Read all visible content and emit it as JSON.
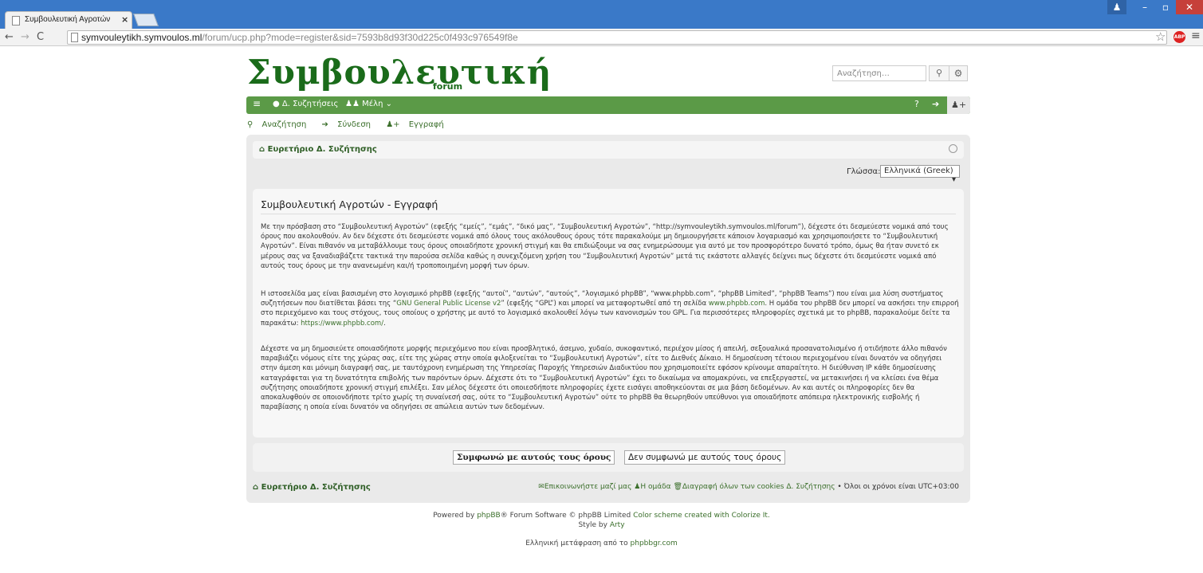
{
  "browser": {
    "tab_title": "Συμβουλευτική Αγροτών",
    "url_host": "symvouleytikh.symvoulos.ml",
    "url_path": "/forum/ucp.php?mode=register&sid=7593b8d93f30d225c0f493c976549f8e",
    "abp_label": "ABP"
  },
  "header": {
    "logo": "Συμβουλευτική",
    "logo_sub": "forum",
    "search_placeholder": "Αναζήτηση…"
  },
  "navbar": {
    "forums_label": "Δ. Συζητήσεις",
    "members_label": "Μέλη"
  },
  "quicklinks": {
    "search": "Αναζήτηση",
    "login": "Σύνδεση",
    "register": "Εγγραφή"
  },
  "breadcrumb": "Ευρετήριο Δ. Συζήτησης",
  "language": {
    "label": "Γλώσσα:",
    "selected": "Ελληνικά (Greek)"
  },
  "panel": {
    "title": "Συμβουλευτική Αγροτών - Εγγραφή",
    "p1": "Με την πρόσβαση στο “Συμβουλευτική Αγροτών” (εφεξής “εμείς”, “εμάς”, “δικό μας”, “Συμβουλευτική Αγροτών”, “http://symvouleytikh.symvoulos.ml/forum”), δέχεστε ότι δεσμεύεστε νομικά από τους όρους που ακολουθούν. Αν δεν δέχεστε ότι δεσμεύεστε νομικά από όλους τους ακόλουθους όρους τότε παρακαλούμε μη δημιουργήσετε κάποιον λογαριασμό και χρησιμοποιήσετε το “Συμβουλευτική Αγροτών”. Είναι πιθανόν να μεταβάλλουμε τους όρους οποιαδήποτε χρονική στιγμή και θα επιδιώξουμε να σας ενημερώσουμε για αυτό με τον προσφορότερο δυνατό τρόπο, όμως θα ήταν συνετό εκ μέρους σας να ξαναδιαβάζετε τακτικά την παρούσα σελίδα καθώς η συνεχιζόμενη χρήση του “Συμβουλευτική Αγροτών” μετά τις εκάστοτε αλλαγές δείχνει πως δέχεστε ότι δεσμεύεστε νομικά από αυτούς τους όρους με την ανανεωμένη και/ή τροποποιημένη μορφή των όρων.",
    "p2_a": "Η ιστοσελίδα μας είναι βασισμένη στο λογισμικό phpBB (εφεξής “αυτοί”, “αυτών”, “αυτούς”, “λογισμικό phpBB”, “www.phpbb.com”, “phpBB Limited”, “phpBB Teams”) που είναι μια λύση συστήματος συζητήσεων που διατίθεται βάσει της “",
    "p2_link1": "GNU General Public License v2",
    "p2_b": "” (εφεξής “GPL”) και μπορεί να μεταφορτωθεί από τη σελίδα ",
    "p2_link2": "www.phpbb.com",
    "p2_c": ". Η ομάδα του phpBB δεν μπορεί να ασκήσει την επιρροή στο περιεχόμενο και τους στόχους, τους οποίους ο χρήστης με αυτό το λογισμικό ακολουθεί λόγω των κανονισμών του GPL. Για περισσότερες πληροφορίες σχετικά με το phpBB, παρακαλούμε δείτε τα παρακάτω: ",
    "p2_link3": "https://www.phpbb.com/",
    "p2_d": ".",
    "p3": "Δέχεστε να μη δημοσιεύετε οποιασδήποτε μορφής περιεχόμενο που είναι προσβλητικό, άσεμνο, χυδαίο, συκοφαντικό, περιέχον μίσος ή απειλή, σεξουαλικά προσανατολισμένο ή οτιδήποτε άλλο πιθανόν παραβιάζει νόμους είτε της χώρας σας, είτε της χώρας στην οποία φιλοξενείται το “Συμβουλευτική Αγροτών”, είτε το Διεθνές Δίκαιο. Η δημοσίευση τέτοιου περιεχομένου είναι δυνατόν να οδηγήσει στην άμεση και μόνιμη διαγραφή σας, με ταυτόχρονη ενημέρωση της Υπηρεσίας Παροχής Υπηρεσιών Διαδικτύου που χρησιμοποιείτε εφόσον κρίνουμε απαραίτητο. Η διεύθυνση IP κάθε δημοσίευσης καταγράφεται για τη δυνατότητα επιβολής των παρόντων όρων. Δέχεστε ότι το “Συμβουλευτική Αγροτών” έχει το δικαίωμα να απομακρύνει, να επεξεργαστεί, να μετακινήσει ή να κλείσει ένα θέμα συζήτησης οποιαδήποτε χρονική στιγμή επιλέξει. Σαν μέλος δέχεστε ότι οποιεσδήποτε πληροφορίες έχετε εισάγει αποθηκεύονται σε μια βάση δεδομένων. Αν και αυτές οι πληροφορίες δεν θα αποκαλυφθούν σε οποιονδήποτε τρίτο χωρίς τη συναίνεσή σας, ούτε το “Συμβουλευτική Αγροτών” ούτε το phpBB θα θεωρηθούν υπεύθυνοι για οποιαδήποτε απόπειρα ηλεκτρονικής εισβολής ή παραβίασης η οποία είναι δυνατόν να οδηγήσει σε απώλεια αυτών των δεδομένων."
  },
  "buttons": {
    "agree": "Συμφωνώ με αυτούς τους όρους",
    "disagree": "Δεν συμφωνώ με αυτούς τους όρους"
  },
  "footer": {
    "breadcrumb": "Ευρετήριο Δ. Συζήτησης",
    "contact": "Επικοινωνήστε μαζί μας",
    "team": "Η ομάδα",
    "cookies": "Διαγραφή όλων των cookies Δ. Συζήτησης",
    "timezone": "Όλοι οι χρόνοι είναι UTC+03:00"
  },
  "copyright": {
    "line1_a": "Powered by ",
    "line1_link1": "phpBB",
    "line1_b": "® Forum Software © phpBB Limited ",
    "line1_link2": "Color scheme created with Colorize It.",
    "line2": "Style by ",
    "line2_link": "Arty",
    "line3": "Ελληνική μετάφραση από το ",
    "line3_link": "phpbbgr.com"
  }
}
